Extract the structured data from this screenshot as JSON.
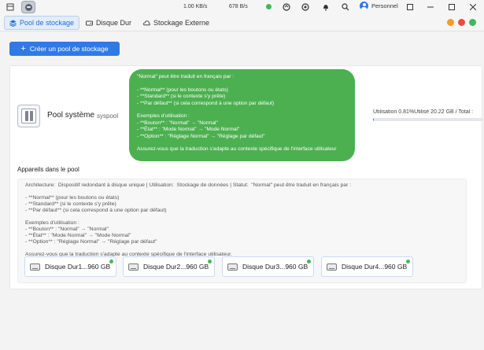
{
  "titlebar": {
    "download_speed": "1.00 KB/s",
    "upload_speed": "678 B/s",
    "user_label": "Personnel"
  },
  "tabs": [
    {
      "label": "Pool de stockage",
      "active": true
    },
    {
      "label": "Disque Dur",
      "active": false
    },
    {
      "label": "Stockage Externe",
      "active": false
    }
  ],
  "status_colors": [
    "#f39a28",
    "#ea4d3d",
    "#42b85a"
  ],
  "actions": {
    "create_pool_label": "Créer un pool de stockage"
  },
  "pool": {
    "name": "Pool système",
    "id": "syspool",
    "usage_text": "Utilisation 0.81%Utilisé 20.22 GB / Total :",
    "usage_percent": 0.81
  },
  "tooltip_text": "\"Normal\" peut être traduit en français par :\n\n- **Normal** (pour les boutons ou états)\n- **Standard** (si le contexte s'y prête)\n- **Par défaut** (si cela correspond à une option par défaut)\n\nExemples d'utilisation :\n- **Bouton** : \"Normal\" → \"Normal\"\n- **État** : \"Mode Normal\" → \"Mode Normal\"\n- **Option** : \"Réglage Normal\" → \"Réglage par défaut\"\n\nAssurez-vous que la traduction s'adapte au contexte spécifique de l'interface utilisateur",
  "devices": {
    "title": "Appareils dans le pool",
    "details": "Architecture:  Dispositif redondant à disque unique | Utilisation:  Stockage de données | Statut:  \"Normal\" peut être traduit en français par :\n\n- **Normal** (pour les boutons ou états)\n- **Standard** (si le contexte s'y prête)\n- **Par défaut** (si cela correspond à une option par défaut)\n\nExemples d'utilisation :\n- **Bouton** : \"Normal\" → \"Normal\"\n- **État** : \"Mode Normal\" → \"Mode Normal\"\n- **Option** : \"Réglage Normal\" → \"Réglage par défaut\"\n\nAssurez-vous que la traduction s'adapte au contexte spécifique de l'interface utilisateur.",
    "disks": [
      {
        "label": "Disque Dur1...960 GB"
      },
      {
        "label": "Disque Dur2...960 GB"
      },
      {
        "label": "Disque Dur3...960 GB"
      },
      {
        "label": "Disque Dur4...960 GB"
      }
    ]
  }
}
